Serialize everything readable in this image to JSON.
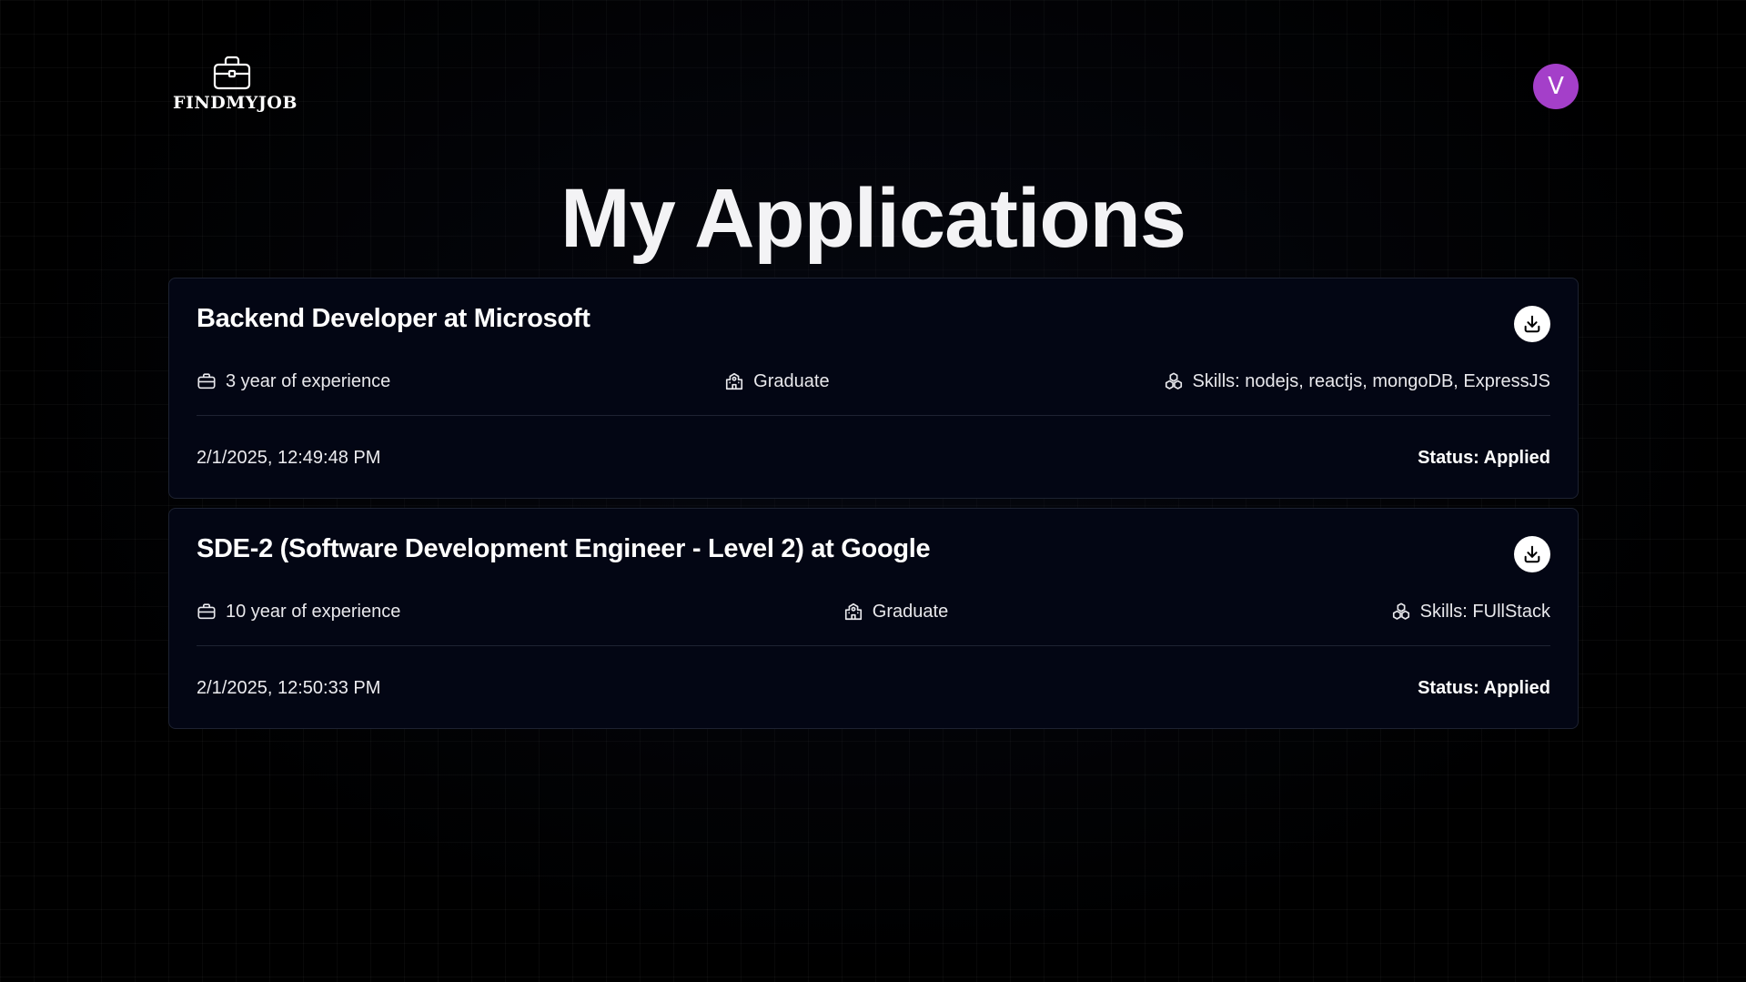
{
  "brand": {
    "name": "FINDMYJOB",
    "icon": "briefcase-icon"
  },
  "user": {
    "avatar_initial": "V",
    "avatar_color": "#a43fc9"
  },
  "page": {
    "title": "My Applications"
  },
  "applications": [
    {
      "title": "Backend Developer at Microsoft",
      "experience": "3 year of experience",
      "education": "Graduate",
      "skills": "Skills: nodejs, reactjs, mongoDB, ExpressJS",
      "applied_at": "2/1/2025, 12:49:48 PM",
      "status": "Status: Applied",
      "download_icon": "download-icon"
    },
    {
      "title": "SDE-2 (Software Development Engineer - Level 2) at Google",
      "experience": "10 year of experience",
      "education": "Graduate",
      "skills": "Skills: FUllStack",
      "applied_at": "2/1/2025, 12:50:33 PM",
      "status": "Status: Applied",
      "download_icon": "download-icon"
    }
  ],
  "colors": {
    "background": "#000000",
    "card": "#030614",
    "card_border": "#1d2231"
  }
}
